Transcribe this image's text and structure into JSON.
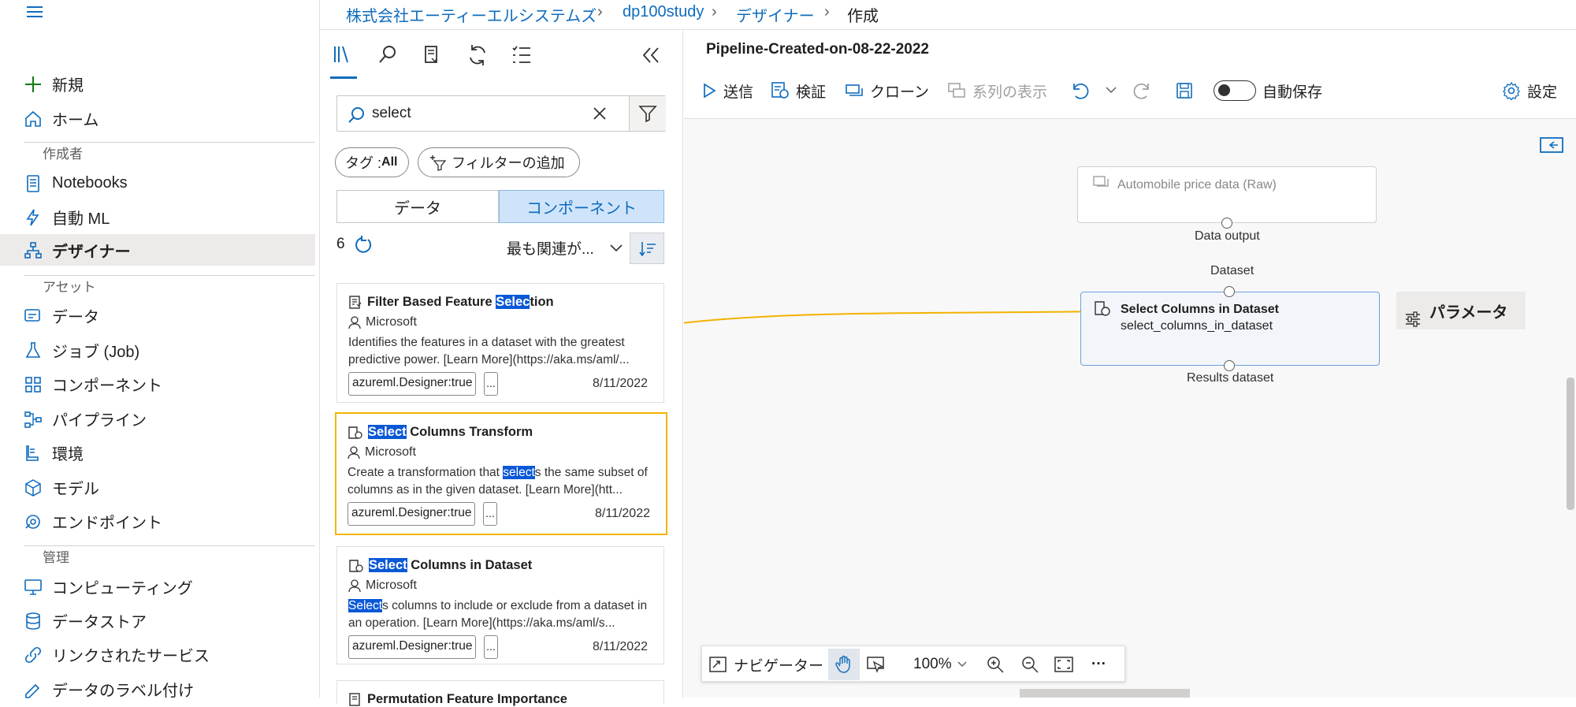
{
  "nav": {
    "new": "新規",
    "home": "ホーム",
    "section_author": "作成者",
    "notebooks": "Notebooks",
    "automl": "自動 ML",
    "designer": "デザイナー",
    "section_assets": "アセット",
    "data": "データ",
    "jobs": "ジョブ (Job)",
    "components": "コンポーネント",
    "pipelines": "パイプライン",
    "environments": "環境",
    "models": "モデル",
    "endpoints": "エンドポイント",
    "section_manage": "管理",
    "compute": "コンピューティング",
    "datastores": "データストア",
    "linked_services": "リンクされたサービス",
    "data_labeling": "データのラベル付け"
  },
  "breadcrumb": {
    "org": "株式会社エーティーエルシステムズ",
    "workspace": "dp100study",
    "designer": "デザイナー",
    "current": "作成"
  },
  "assets": {
    "search_value": "select",
    "tag_pill_label": "タグ : ",
    "tag_pill_value": "All",
    "add_filter": "フィルターの追加",
    "seg_data": "データ",
    "seg_components": "コンポーネント",
    "count": "6",
    "sort_label": "最も関連が...",
    "cards": [
      {
        "title_pre": "Filter Based Feature ",
        "title_mark": "Selec",
        "title_post": "tion",
        "author": "Microsoft",
        "desc": "Identifies the features in a dataset with the greatest predictive power. [Learn More](https://aka.ms/aml/...",
        "tag": "azureml.Designer:true",
        "more": "...",
        "date": "8/11/2022"
      },
      {
        "title_pre": "",
        "title_mark": "Select",
        "title_post": " Columns Transform",
        "author": "Microsoft",
        "desc_pre": "Create a transformation that ",
        "desc_mark": "select",
        "desc_post": "s the same subset of columns as in the given dataset. [Learn More](htt...",
        "tag": "azureml.Designer:true",
        "more": "...",
        "date": "8/11/2022"
      },
      {
        "title_pre": "",
        "title_mark": "Select",
        "title_post": " Columns in Dataset",
        "author": "Microsoft",
        "desc_pre": "",
        "desc_mark": "Select",
        "desc_post": "s columns to include or exclude from a dataset in an operation. [Learn More](https://aka.ms/aml/s...",
        "tag": "azureml.Designer:true",
        "more": "...",
        "date": "8/11/2022"
      },
      {
        "title": "Permutation Feature Importance"
      }
    ]
  },
  "pipeline": {
    "title": "Pipeline-Created-on-08-22-2022"
  },
  "toolbar": {
    "submit": "送信",
    "validate": "検証",
    "clone": "クローン",
    "lineage": "系列の表示",
    "autosave": "自動保存",
    "settings": "設定"
  },
  "canvas": {
    "node1": {
      "title": "Automobile price data (Raw)",
      "output_label": "Data output"
    },
    "node2": {
      "input_label": "Dataset",
      "title": "Select Columns in Dataset",
      "subtitle": "select_columns_in_dataset",
      "output_label": "Results dataset"
    },
    "params_tab": "パラメータ"
  },
  "navbar": {
    "navigator": "ナビゲーター",
    "zoom": "100%",
    "more": "···"
  },
  "colors": {
    "accent": "#0f6cbd",
    "highlight_border": "#f0b400",
    "search_mark": "#0b58d6",
    "connector": "#f2b200"
  }
}
